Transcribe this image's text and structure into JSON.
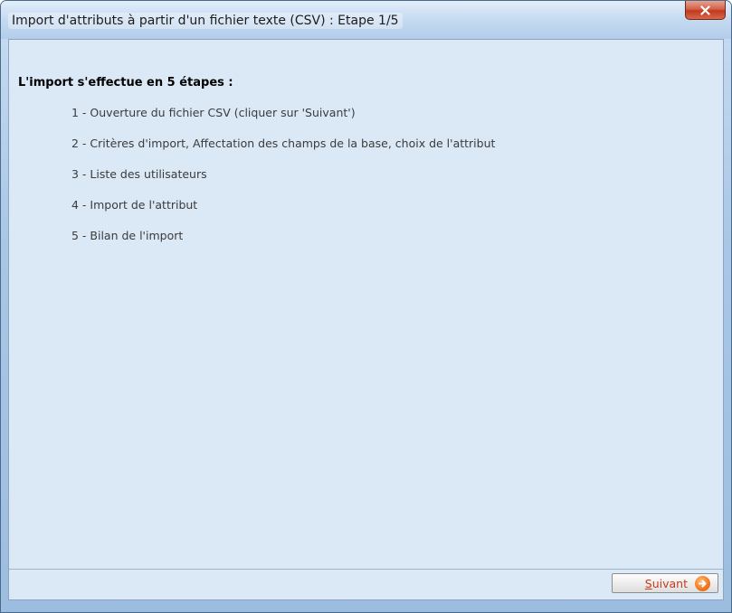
{
  "window": {
    "title": "Import d'attributs à partir d'un fichier texte (CSV) : Etape 1/5",
    "close_icon": "close-icon"
  },
  "main": {
    "heading": "L'import s'effectue en 5 étapes :",
    "steps": [
      "1 - Ouverture du fichier CSV (cliquer sur 'Suivant')",
      "2 - Critères d'import, Affectation des champs de la base, choix de l'attribut",
      "3 - Liste des utilisateurs",
      "4 - Import de l'attribut",
      "5 - Bilan de l'import"
    ]
  },
  "footer": {
    "next_button": {
      "accel": "S",
      "label_rest": "uivant",
      "icon": "arrow-right-icon"
    }
  },
  "colors": {
    "client_bg": "#dbe8f6",
    "frame": "#9dbde0",
    "close_red": "#c2391f",
    "next_text": "#c83a1a"
  }
}
